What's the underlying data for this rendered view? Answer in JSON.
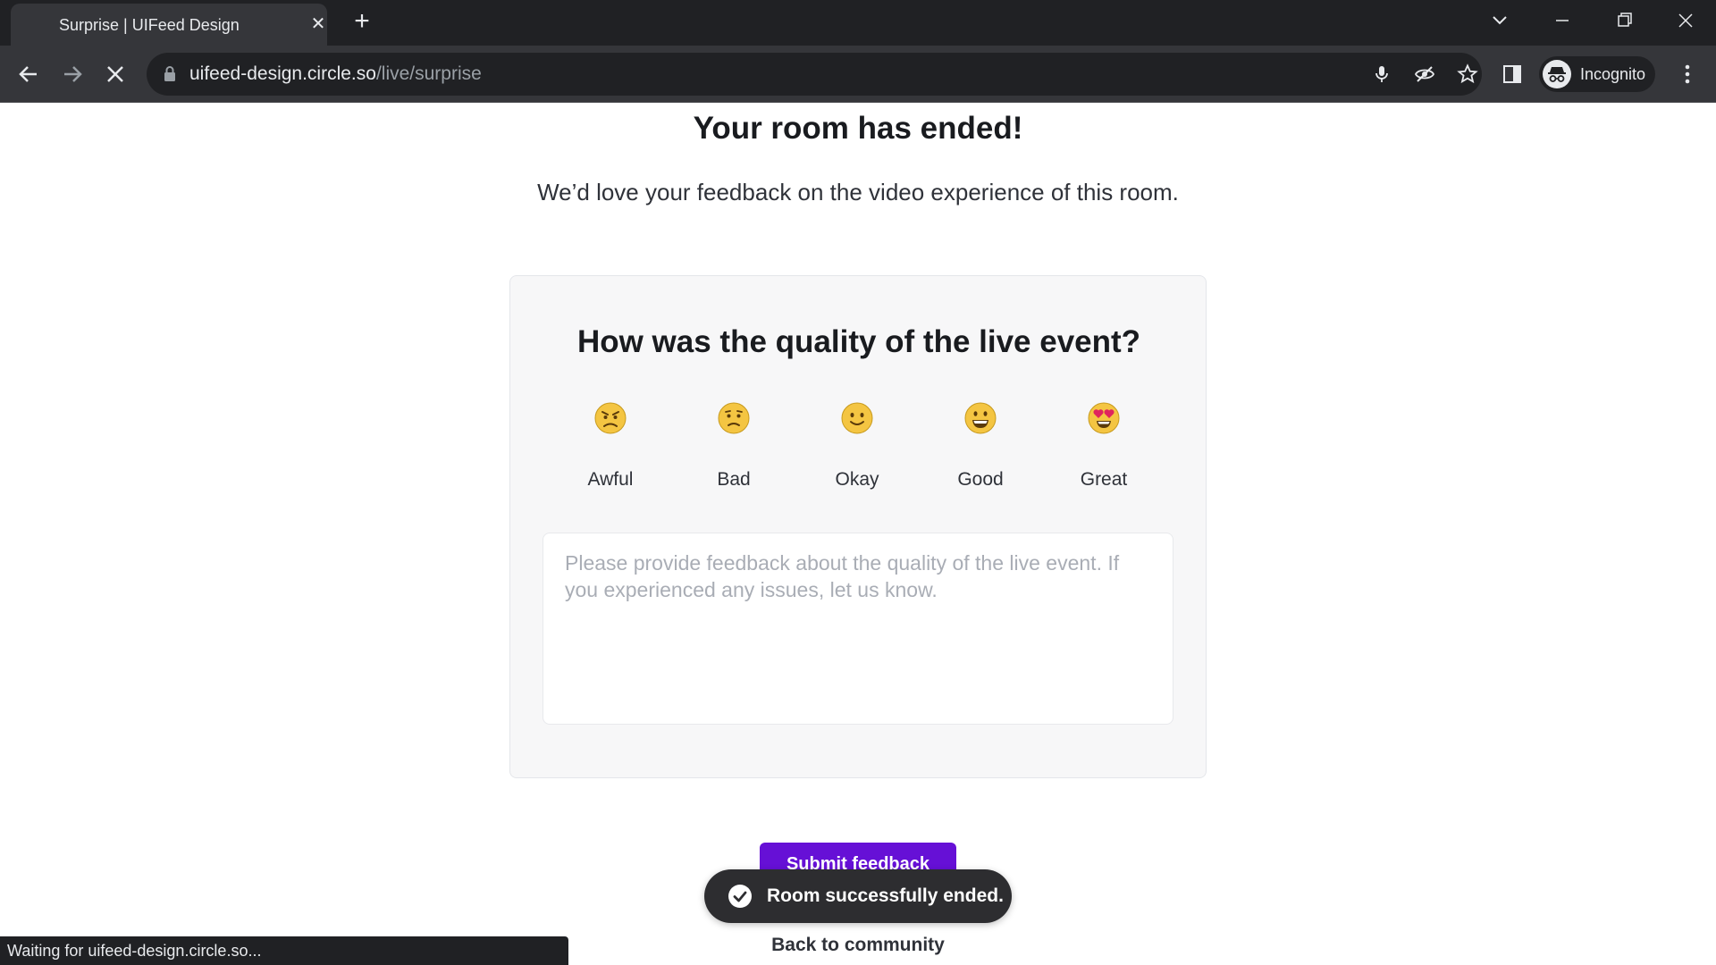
{
  "browser": {
    "tab_title": "Surprise | UIFeed Design",
    "url_host": "uifeed-design.circle.so",
    "url_path": "/live/surprise",
    "profile_label": "Incognito",
    "status_text": "Waiting for uifeed-design.circle.so..."
  },
  "page": {
    "heading": "Your room has ended!",
    "subtext": "We’d love your feedback on the video experience of this room."
  },
  "survey": {
    "question": "How was the quality of the live event?",
    "ratings": [
      {
        "label": "Awful",
        "icon": "angry-face-icon"
      },
      {
        "label": "Bad",
        "icon": "frowning-face-icon"
      },
      {
        "label": "Okay",
        "icon": "slightly-smiling-face-icon"
      },
      {
        "label": "Good",
        "icon": "grinning-face-icon"
      },
      {
        "label": "Great",
        "icon": "heart-eyes-face-icon"
      }
    ],
    "textarea_placeholder": "Please provide feedback about the quality of the live event. If you experienced any issues, let us know.",
    "textarea_value": ""
  },
  "actions": {
    "submit_label": "Submit feedback",
    "back_label": "Back to community"
  },
  "toast": {
    "message": "Room successfully ended.",
    "icon": "check-circle-icon"
  },
  "colors": {
    "accent": "#6610d6",
    "toast_bg": "#2d2d30",
    "chrome_dark": "#202124",
    "chrome_toolbar": "#35363a",
    "emoji_yellow": "#f4c542"
  }
}
